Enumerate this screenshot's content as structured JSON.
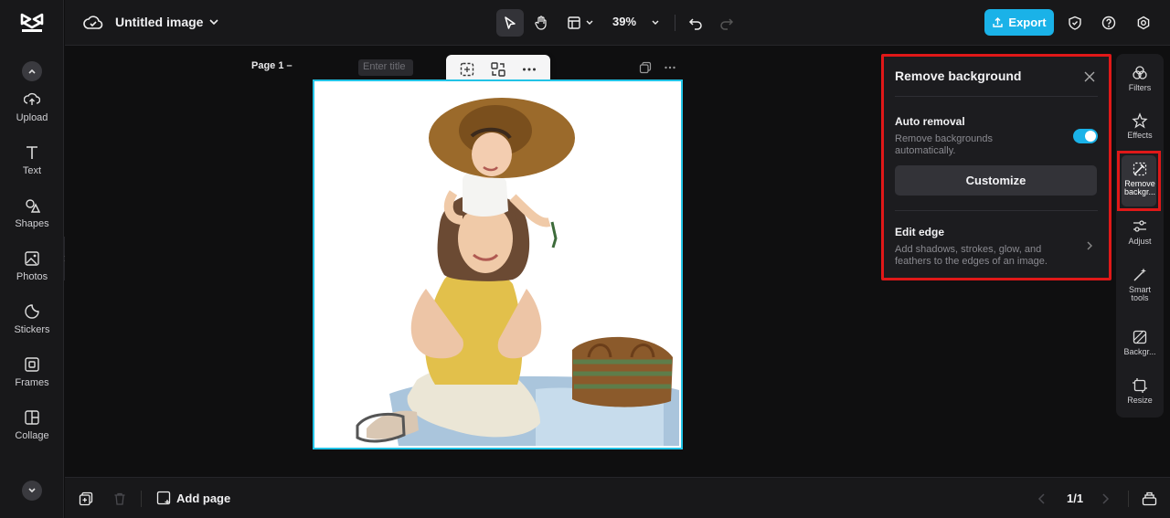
{
  "topbar": {
    "doc_title": "Untitled image",
    "zoom": "39%",
    "export_label": "Export"
  },
  "leftrail": {
    "items": [
      {
        "label": "Upload",
        "icon": "upload-icon"
      },
      {
        "label": "Text",
        "icon": "text-icon"
      },
      {
        "label": "Shapes",
        "icon": "shapes-icon"
      },
      {
        "label": "Photos",
        "icon": "photos-icon"
      },
      {
        "label": "Stickers",
        "icon": "stickers-icon"
      },
      {
        "label": "Frames",
        "icon": "frames-icon"
      },
      {
        "label": "Collage",
        "icon": "collage-icon"
      }
    ]
  },
  "canvas": {
    "page_label": "Page 1 –",
    "title_placeholder": "Enter title"
  },
  "panel": {
    "title": "Remove background",
    "auto_title": "Auto removal",
    "auto_desc": "Remove backgrounds automatically.",
    "auto_enabled": true,
    "customize_label": "Customize",
    "edge_title": "Edit edge",
    "edge_desc": "Add shadows, strokes, glow, and feathers to the edges of an image."
  },
  "rightrail": {
    "items": [
      {
        "label": "Filters",
        "icon": "filters-icon"
      },
      {
        "label": "Effects",
        "icon": "effects-icon"
      },
      {
        "label": "Remove backgr...",
        "icon": "remove-background-icon",
        "active": true
      },
      {
        "label": "Adjust",
        "icon": "adjust-icon"
      },
      {
        "label": "Smart tools",
        "icon": "smart-tools-icon"
      },
      {
        "label": "Backgr...",
        "icon": "background-icon"
      },
      {
        "label": "Resize",
        "icon": "resize-icon"
      }
    ]
  },
  "bottombar": {
    "add_page_label": "Add page",
    "pager": "1/1"
  },
  "colors": {
    "accent": "#1ab2e8",
    "highlight": "#e01818",
    "selection": "#22c3e6"
  }
}
